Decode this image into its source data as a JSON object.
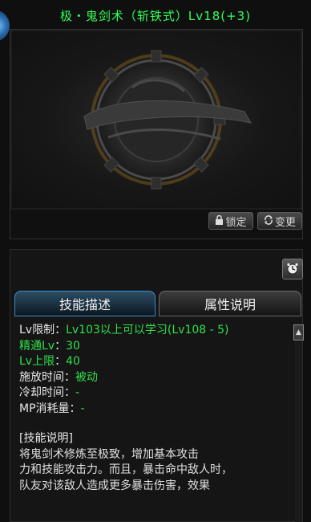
{
  "title": "极・鬼剑术（斩铁式）Lv18(+3)",
  "buttons": {
    "lock_icon": "lock-icon",
    "lock_label": "锁定",
    "change_icon": "swap-icon",
    "change_label": "变更"
  },
  "tabs": [
    {
      "label": "技能描述",
      "active": true
    },
    {
      "label": "属性说明",
      "active": false
    }
  ],
  "stats": {
    "lv_limit_label": "Lv限制",
    "lv_limit_value": "Lv103以上可以学习(Lv108 - 5)",
    "mastery_label": "精通Lv",
    "mastery_value": "30",
    "max_label": "Lv上限",
    "max_value": "40",
    "cast_label": "施放时间",
    "cast_value": "被动",
    "cooldown_label": "冷却时间",
    "cooldown_value": "-",
    "mp_label": "MP消耗量",
    "mp_value": "-"
  },
  "description": {
    "heading": "[技能说明]",
    "lines": [
      "    将鬼剑术修炼至极致，增加基本攻击",
      "力和技能攻击力。而且，暴击命中敌人时，",
      " 队友对该敌人造成更多暴击伤害，效果"
    ]
  },
  "colors": {
    "title": "#33ff5a",
    "value": "#2fe04a",
    "active_tab_border": "#3a8fd0"
  }
}
